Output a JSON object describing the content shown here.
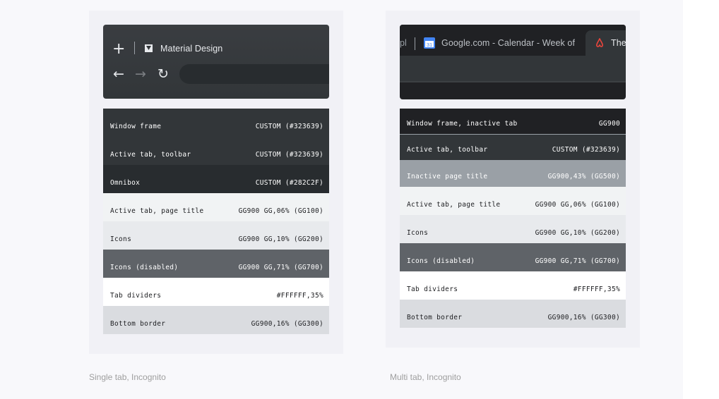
{
  "left_panel": {
    "caption": "Single tab, Incognito",
    "browser": {
      "new_tab_glyph": "+",
      "tab_title": "Material Design",
      "back_glyph": "←",
      "forward_glyph": "→",
      "reload_glyph": "↻"
    },
    "swatches": [
      {
        "label": "Window frame",
        "value": "CUSTOM (#323639)",
        "bg": "#323639",
        "fg": "#ffffff"
      },
      {
        "label": "Active tab, toolbar",
        "value": "CUSTOM (#323639)",
        "bg": "#323639",
        "fg": "#ffffff"
      },
      {
        "label": "Omnibox",
        "value": "CUSTOM (#282C2F)",
        "bg": "#282c2f",
        "fg": "#ffffff"
      },
      {
        "label": "Active tab, page title",
        "value": "GG900 GG,06% (GG100)",
        "bg": "#f1f3f4",
        "fg": "#202124"
      },
      {
        "label": "Icons",
        "value": "GG900 GG,10% (GG200)",
        "bg": "#e8eaed",
        "fg": "#202124"
      },
      {
        "label": "Icons (disabled)",
        "value": "GG900 GG,71% (GG700)",
        "bg": "#5f6368",
        "fg": "#ffffff"
      },
      {
        "label": "Tab dividers",
        "value": "#FFFFFF,35%",
        "bg": "#ffffff",
        "fg": "#202124"
      },
      {
        "label": "Bottom border",
        "value": "GG900,16% (GG300)",
        "bg": "#dadce0",
        "fg": "#202124"
      }
    ]
  },
  "right_panel": {
    "caption": "Multi tab, Incognito",
    "browser": {
      "partial_tab_text": "pl",
      "tab2_title": "Google.com - Calendar - Week of J",
      "calendar_icon_text": "31",
      "tab3_title": "The"
    },
    "swatches": [
      {
        "label": "Window frame, inactive tab",
        "value": "GG900",
        "bg": "#202124",
        "fg": "#ffffff"
      },
      {
        "label": "Active tab, toolbar",
        "value": "CUSTOM (#323639)",
        "bg": "#323639",
        "fg": "#ffffff"
      },
      {
        "label": "Inactive page title",
        "value": "GG900,43% (GG500)",
        "bg": "#9aa0a6",
        "fg": "#ffffff"
      },
      {
        "label": "Active tab, page title",
        "value": "GG900 GG,06% (GG100)",
        "bg": "#f1f3f4",
        "fg": "#202124"
      },
      {
        "label": "Icons",
        "value": "GG900 GG,10% (GG200)",
        "bg": "#e8eaed",
        "fg": "#202124"
      },
      {
        "label": "Icons (disabled)",
        "value": "GG900 GG,71% (GG700)",
        "bg": "#5f6368",
        "fg": "#ffffff"
      },
      {
        "label": "Tab dividers",
        "value": "#FFFFFF,35%",
        "bg": "#ffffff",
        "fg": "#202124"
      },
      {
        "label": "Bottom border",
        "value": "GG900,16% (GG300)",
        "bg": "#dadce0",
        "fg": "#202124"
      }
    ]
  }
}
